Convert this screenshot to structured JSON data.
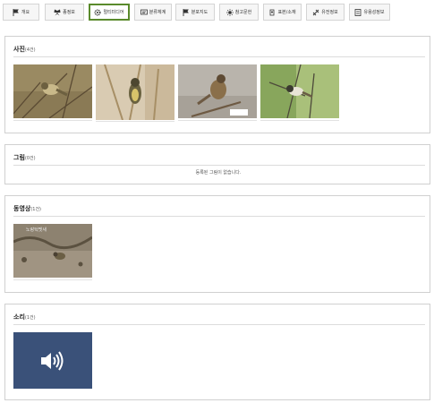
{
  "tabs": [
    {
      "label": "개요",
      "icon": "flag-icon",
      "active": false
    },
    {
      "label": "종정보",
      "icon": "butterfly-icon",
      "active": false
    },
    {
      "label": "멀티미디어",
      "icon": "gear-icon",
      "active": true
    },
    {
      "label": "분류체계",
      "icon": "tree-icon",
      "active": false
    },
    {
      "label": "분포지도",
      "icon": "flag-icon",
      "active": false
    },
    {
      "label": "참고문헌",
      "icon": "sun-icon",
      "active": false
    },
    {
      "label": "표본/소재",
      "icon": "specimen-icon",
      "active": false
    },
    {
      "label": "유전정보",
      "icon": "dna-icon",
      "active": false
    },
    {
      "label": "유용성정보",
      "icon": "document-icon",
      "active": false
    }
  ],
  "photos": {
    "title": "사진",
    "count": "(4건)"
  },
  "drawings": {
    "title": "그림",
    "count": "(0건)",
    "empty_text": "등록된 그림이 없습니다."
  },
  "videos": {
    "title": "동영상",
    "count": "(1건)",
    "overlay_text": "노랑턱멧새"
  },
  "sounds": {
    "title": "소리",
    "count": "(1건)",
    "icon": "speaker-icon"
  },
  "colors": {
    "active_border": "#5a8a2c",
    "sound_bg": "#3a5179"
  }
}
